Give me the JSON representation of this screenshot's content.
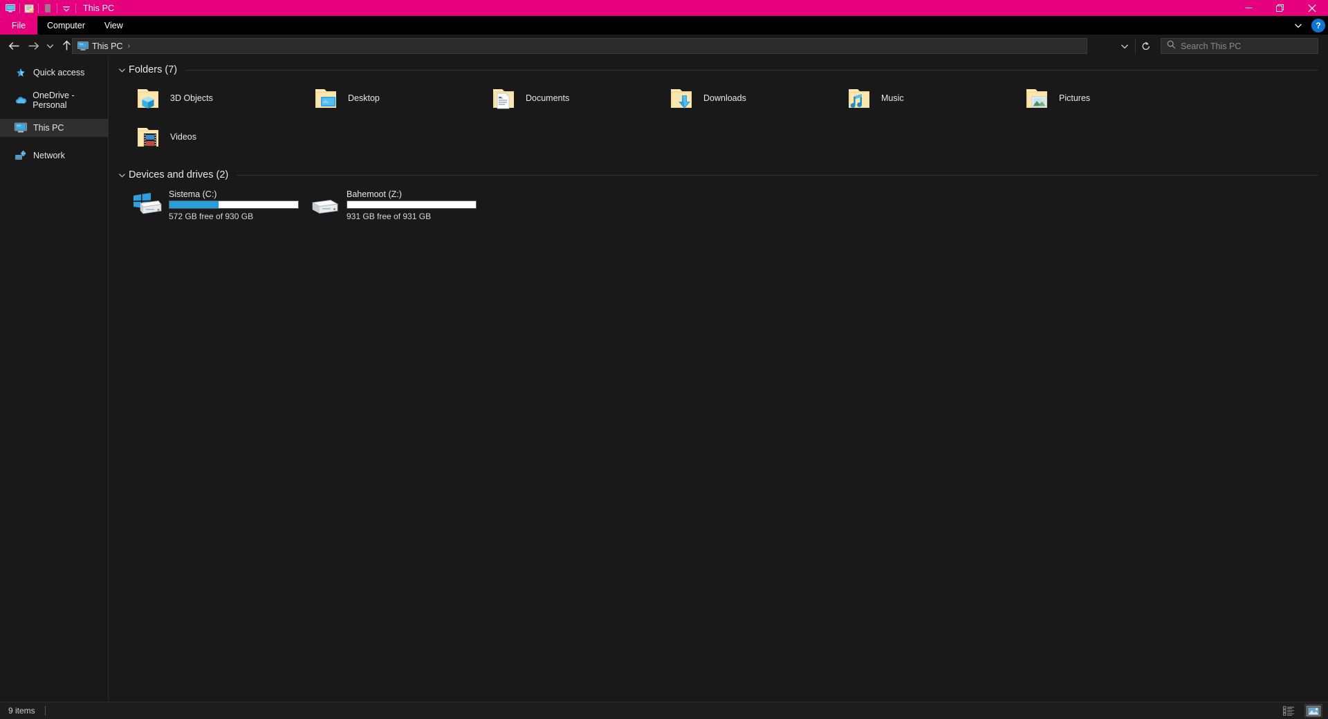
{
  "window": {
    "title": "This PC",
    "accent_color": "#e6007e",
    "background": "#191919",
    "quick_access_toolbar": [
      {
        "name": "properties-icon",
        "label": "Properties"
      },
      {
        "name": "new-folder-icon",
        "label": "New folder"
      },
      {
        "name": "undo-icon",
        "label": "Undo"
      },
      {
        "name": "customize-qat-chevron-icon",
        "label": "Customize Quick Access Toolbar"
      }
    ],
    "controls": {
      "minimize": "Minimize",
      "maximize": "Restore Down",
      "close": "Close"
    }
  },
  "ribbon": {
    "tabs": [
      {
        "label": "File",
        "active": true
      },
      {
        "label": "Computer",
        "active": false
      },
      {
        "label": "View",
        "active": false
      }
    ],
    "collapse_label": "Minimize the Ribbon",
    "help_label": "?"
  },
  "navigation": {
    "back_label": "Back",
    "forward_label": "Forward",
    "recent_label": "Recent locations",
    "up_label": "Up",
    "breadcrumb": {
      "icon": "this-pc-icon",
      "segments": [
        "This PC"
      ],
      "trailing_separator": "›"
    },
    "history_dropdown_label": "Previous Locations",
    "refresh_label": "Refresh"
  },
  "search": {
    "placeholder": "Search This PC",
    "icon": "search-icon"
  },
  "sidebar": {
    "items": [
      {
        "label": "Quick access",
        "icon": "pin-icon",
        "selected": false
      },
      {
        "label": "OneDrive - Personal",
        "icon": "cloud-icon",
        "selected": false
      },
      {
        "label": "This PC",
        "icon": "this-pc-icon",
        "selected": true
      },
      {
        "label": "Network",
        "icon": "network-icon",
        "selected": false
      }
    ]
  },
  "main": {
    "groups": [
      {
        "title": "Folders (7)",
        "expanded": true,
        "items": [
          {
            "label": "3D Objects",
            "icon": "folder-3d-objects-icon"
          },
          {
            "label": "Desktop",
            "icon": "folder-desktop-icon"
          },
          {
            "label": "Documents",
            "icon": "folder-documents-icon"
          },
          {
            "label": "Downloads",
            "icon": "folder-downloads-icon"
          },
          {
            "label": "Music",
            "icon": "folder-music-icon"
          },
          {
            "label": "Pictures",
            "icon": "folder-pictures-icon"
          },
          {
            "label": "Videos",
            "icon": "folder-videos-icon"
          }
        ]
      },
      {
        "title": "Devices and drives (2)",
        "expanded": true,
        "drives": [
          {
            "name": "Sistema (C:)",
            "icon": "windows-drive-icon",
            "free_text": "572 GB free of 930 GB",
            "free_gb": 572,
            "total_gb": 930,
            "used_percent": 38,
            "bar_color": "#26a0da"
          },
          {
            "name": "Bahemoot (Z:)",
            "icon": "drive-icon",
            "free_text": "931 GB free of 931 GB",
            "free_gb": 931,
            "total_gb": 931,
            "used_percent": 0,
            "bar_color": "#26a0da"
          }
        ]
      }
    ]
  },
  "statusbar": {
    "item_count": "9 items",
    "view_details_label": "Details view",
    "view_large_icons_label": "Large icons view"
  }
}
